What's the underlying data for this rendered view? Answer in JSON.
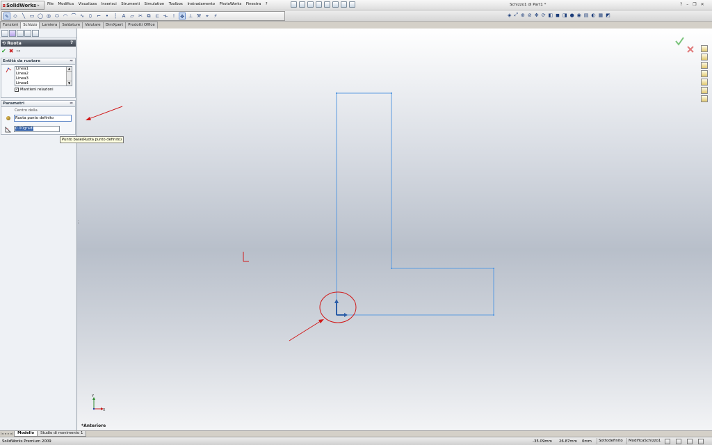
{
  "app": {
    "brand": "SolidWorks",
    "document_title": "Schizzo1 di Part1 *",
    "menus": [
      "File",
      "Modifica",
      "Visualizza",
      "Inserisci",
      "Strumenti",
      "Simulation",
      "Toolbox",
      "Instradamento",
      "PhotoWorks",
      "Finestra",
      "?"
    ]
  },
  "command_tabs": [
    {
      "label": "Funzioni",
      "active": false
    },
    {
      "label": "Schizzo",
      "active": true
    },
    {
      "label": "Lamiera",
      "active": false
    },
    {
      "label": "Saldature",
      "active": false
    },
    {
      "label": "Valutare",
      "active": false
    },
    {
      "label": "DimXpert",
      "active": false
    },
    {
      "label": "Prodotti Office",
      "active": false
    }
  ],
  "property_manager": {
    "title": "Ruota",
    "help": "?",
    "entities_group": {
      "title": "Entità da ruotare",
      "items": [
        "Linea1",
        "Linea2",
        "Linea3",
        "Linea4"
      ],
      "keep_relations": {
        "label": "Mantieni relazioni",
        "checked": true
      }
    },
    "parameters_group": {
      "title": "Parametri",
      "center_label": "Centro della",
      "base_point_value": "Ruota punto definito",
      "angle_value": "0.00gradi"
    },
    "tooltip": "Punto base(Ruota punto definito)"
  },
  "viewport": {
    "view_label": "*Anteriore",
    "triad": {
      "y": "Y",
      "x": "X"
    },
    "sketch_color": "#5b9be0",
    "annotation_color": "#d11a1a"
  },
  "bottom_tabs": [
    {
      "label": "Modello",
      "active": true
    },
    {
      "label": "Studio di movimento 1",
      "active": false
    }
  ],
  "status": {
    "product": "SolidWorks Premium 2009",
    "x": "-35.09mm",
    "y": "26.87mm",
    "z": "0mm",
    "definition": "Sottodefinito",
    "mode": "ModificaSchizzo1"
  }
}
